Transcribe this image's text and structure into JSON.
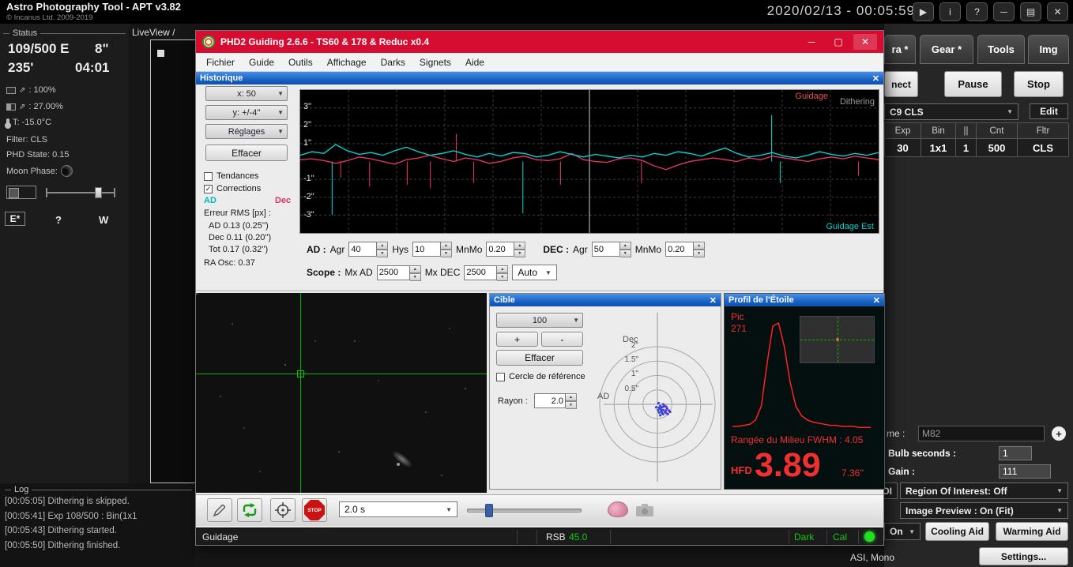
{
  "titlebar": {
    "app_title": "Astro Photography Tool - APT v3.82",
    "copyright": "© Incanus Ltd. 2009-2019",
    "clock": "2020/02/13 - 00:05:59"
  },
  "status_panel": {
    "header": "Status",
    "exp_count": "109/500 E",
    "exp_len": "8\"",
    "angle": "235'",
    "countdown": "04:01",
    "disk": ": 100%",
    "battery": ": 27.00%",
    "temp": "T: -15.0°C",
    "filter": "Filter: CLS",
    "phd_state": "PHD State: 0.15",
    "moon": "Moon Phase:",
    "east": "E*",
    "question": "?",
    "west": "W"
  },
  "liveview": {
    "label": "LiveView /"
  },
  "log": {
    "header": "Log",
    "entries": [
      "[00:05:05] Dithering is skipped.",
      "[00:05:41] Exp 108/500 : Bin(1x1",
      "[00:05:43] Dithering started.",
      "[00:05:50] Dithering finished."
    ]
  },
  "right_panel": {
    "tab_camera": "ra *",
    "tab_gear": "Gear *",
    "tab_tools": "Tools",
    "tab_img": "Img",
    "connect": "nect",
    "pause": "Pause",
    "stop": "Stop",
    "plan": "C9 CLS",
    "edit": "Edit",
    "table_headers": [
      "Exp",
      "Bin",
      "||",
      "Cnt",
      "Fltr"
    ],
    "table_row": [
      "30",
      "1x1",
      "1",
      "500",
      "CLS"
    ],
    "name_label": "me :",
    "name_value": "M82",
    "bulb_label": "Bulb seconds :",
    "bulb_value": "1",
    "gain_label": "Gain :",
    "gain_value": "111",
    "roi_partial": "OI",
    "roi": "Region Of Interest: Off",
    "preview": "Image Preview : On (Fit)",
    "on_partial": "On",
    "cooling": "Cooling Aid",
    "warming": "Warming Aid",
    "settings": "Settings...",
    "camera_info": "ASI, Mono"
  },
  "phd2": {
    "title": "PHD2 Guiding 2.6.6 - TS60 & 178 & Reduc x0.4",
    "menu": [
      "Fichier",
      "Guide",
      "Outils",
      "Affichage",
      "Darks",
      "Signets",
      "Aide"
    ],
    "history": {
      "title": "Historique",
      "combo_x": "x: 50",
      "combo_y": "y: +/-4''",
      "combo_settings": "Réglages",
      "btn_clear": "Effacer",
      "chk_trend": "Tendances",
      "chk_corrections": "Corrections",
      "ad": "AD",
      "dec": "Dec",
      "rms_header": "Erreur RMS [px] :",
      "rms_ad": "AD  0.13 (0.25'')",
      "rms_dec": "Dec 0.11 (0.20'')",
      "rms_tot": "Tot 0.17 (0.32'')",
      "ra_osc": "RA Osc: 0.37",
      "yticks": [
        "3\"",
        "2\"",
        "1\"",
        "-1\"",
        "-2\"",
        "-3\""
      ],
      "label_guide": "Guidage",
      "label_dithering": "Dithering",
      "label_east": "Guidage Est",
      "chart_data": {
        "type": "line",
        "ylim": [
          -4,
          4
        ],
        "divider_x": 0.5,
        "series": [
          {
            "name": "AD",
            "color": "#00dcdc",
            "values": [
              0.35,
              0.55,
              0.45,
              0.95,
              0.6,
              0.4,
              0.5,
              0.35,
              0.6,
              0.8,
              0.55,
              0.35,
              0.45,
              0.6,
              0.4,
              0.25,
              0.45,
              0.3,
              0.5,
              0.45,
              0.25,
              0.35,
              0.55,
              0.4,
              0.25,
              0.4,
              0.3,
              0.2,
              0.35,
              0.25,
              0.45,
              0.35,
              0.55,
              0.45,
              0.3,
              0.55,
              0.75,
              0.45,
              0.25,
              0.35,
              0.5,
              0.3,
              0.2,
              0.35,
              0.55,
              0.4,
              0.3,
              0.45,
              0.35,
              0.5
            ]
          },
          {
            "name": "Dec",
            "color": "#f23568",
            "values": [
              0.1,
              0.15,
              0.05,
              -0.1,
              0.05,
              0.25,
              0.15,
              0.0,
              -0.15,
              0.1,
              0.2,
              0.35,
              0.15,
              0.0,
              0.2,
              0.1,
              -0.1,
              0.0,
              0.2,
              0.3,
              0.1,
              0.05,
              0.15,
              0.45,
              0.1,
              0.0,
              -0.05,
              0.15,
              0.2,
              0.05,
              -0.25,
              -0.45,
              -0.2,
              0.0,
              0.1,
              0.2,
              0.1,
              0.0,
              0.2,
              0.1,
              0.3,
              0.2,
              0.1,
              0.0,
              0.15,
              0.25,
              0.15,
              0.3,
              0.2,
              0.1
            ]
          }
        ],
        "corrections": [
          {
            "x": 0.055,
            "v": -3.0,
            "s": "AD"
          },
          {
            "x": 0.07,
            "v": -0.9,
            "s": "Dec"
          },
          {
            "x": 0.12,
            "v": -1.4,
            "s": "Dec"
          },
          {
            "x": 0.185,
            "v": -1.3,
            "s": "Dec"
          },
          {
            "x": 0.225,
            "v": -1.5,
            "s": "Dec"
          },
          {
            "x": 0.27,
            "v": 1.55,
            "s": "Dec"
          },
          {
            "x": 0.3,
            "v": -1.2,
            "s": "Dec"
          },
          {
            "x": 0.385,
            "v": -2.9,
            "s": "AD"
          },
          {
            "x": 0.45,
            "v": -1.3,
            "s": "Dec"
          },
          {
            "x": 0.59,
            "v": -1.2,
            "s": "Dec"
          },
          {
            "x": 0.815,
            "v": 2.6,
            "s": "AD"
          },
          {
            "x": 0.83,
            "v": -1.2,
            "s": "AD"
          },
          {
            "x": 0.965,
            "v": -0.8,
            "s": "Dec"
          }
        ]
      }
    },
    "guide_controls": {
      "ad": "AD :",
      "agr": "Agr",
      "agr_val": "40",
      "hys": "Hys",
      "hys_val": "10",
      "mnmo": "MnMo",
      "mnmo_val": "0.20",
      "dec": "DEC :",
      "dec_agr": "Agr",
      "dec_agr_val": "50",
      "dec_mnmo": "MnMo",
      "dec_mnmo_val": "0.20",
      "scope": "Scope :",
      "mxad": "Mx AD",
      "mxad_val": "2500",
      "mxdec": "Mx DEC",
      "mxdec_val": "2500",
      "auto": "Auto"
    },
    "target": {
      "title": "Cible",
      "zoom": "100",
      "plus": "+",
      "minus": "-",
      "clear": "Effacer",
      "ref_circle": "Cercle de référence",
      "rayon": "Rayon :",
      "rayon_val": "2.0",
      "axis_dec": "Dec",
      "axis_ad": "AD",
      "rings": [
        "2\"",
        "1.5\"",
        "1\"",
        "0.5\""
      ],
      "chart_data": {
        "type": "scatter",
        "rings_arcsec": [
          0.5,
          1,
          1.5,
          2
        ],
        "points": [
          [
            0.12,
            -0.18
          ],
          [
            0.22,
            -0.08
          ],
          [
            0.16,
            -0.3
          ],
          [
            0.3,
            -0.2
          ],
          [
            0.06,
            -0.12
          ],
          [
            0.26,
            -0.26
          ],
          [
            0.1,
            -0.38
          ],
          [
            0.34,
            -0.14
          ],
          [
            0.2,
            -0.34
          ],
          [
            0.02,
            -0.2
          ],
          [
            0.16,
            -0.1
          ],
          [
            0.3,
            -0.3
          ],
          [
            0.4,
            -0.22
          ],
          [
            0.2,
            -0.2
          ],
          [
            0.1,
            -0.16
          ],
          [
            0.24,
            -0.04
          ],
          [
            0.06,
            -0.28
          ],
          [
            0.3,
            -0.08
          ],
          [
            0.14,
            -0.24
          ],
          [
            0.36,
            -0.34
          ],
          [
            0.44,
            -0.26
          ],
          [
            0.2,
            0.0
          ],
          [
            0.1,
            -0.06
          ],
          [
            0.04,
            0.04
          ],
          [
            -0.04,
            -0.1
          ]
        ],
        "colors": [
          "#2c49d8",
          "#5a3bd0"
        ]
      }
    },
    "profile": {
      "title": "Profil de l'Étoile",
      "pic": "Pic",
      "pic_val": "271",
      "fwhm": "Rangée du Milieu FWHM : 4.05",
      "hfd": "HFD",
      "hfd_val": "3.89",
      "hfd_arcsec": "7.36''",
      "chart_data": {
        "type": "line",
        "color": "#ff2222",
        "values": [
          0.03,
          0.03,
          0.04,
          0.05,
          0.09,
          0.22,
          0.62,
          0.97,
          1.0,
          0.78,
          0.45,
          0.22,
          0.13,
          0.09,
          0.07,
          0.06,
          0.05,
          0.04,
          0.04,
          0.03,
          0.03,
          0.03,
          0.02,
          0.02,
          0.02
        ]
      }
    },
    "toolbar": {
      "exposure": "2.0 s",
      "stop": "STOP"
    },
    "statusbar": {
      "mode": "Guidage",
      "rsb": "RSB",
      "rsb_val": "45.0",
      "dark": "Dark",
      "cal": "Cal"
    }
  }
}
